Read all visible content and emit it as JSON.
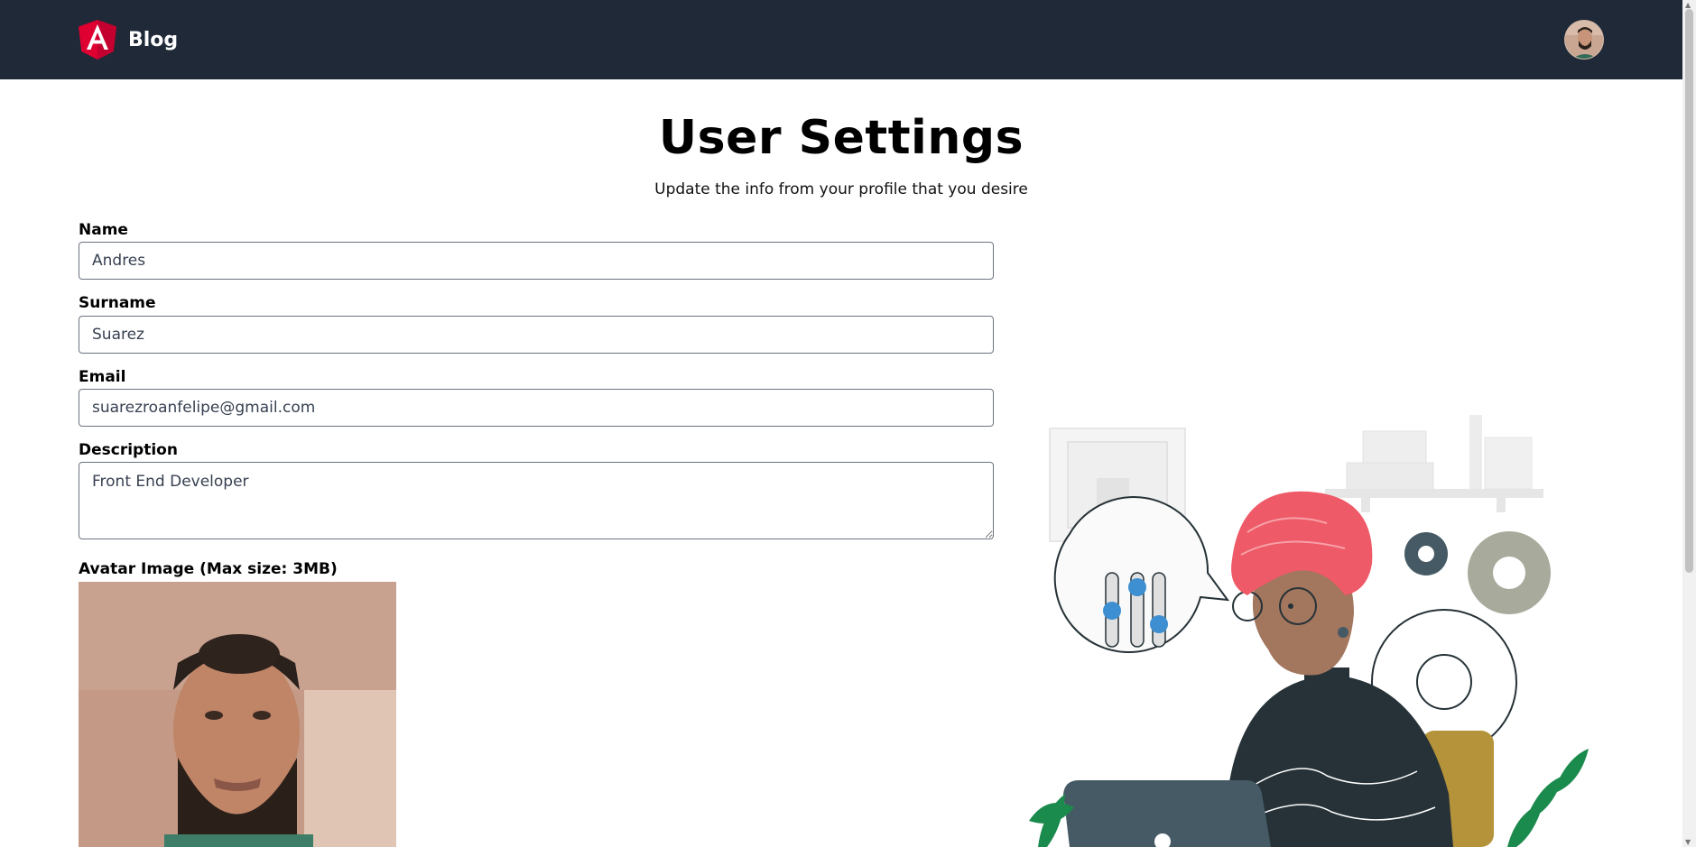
{
  "nav": {
    "brand": "Blog",
    "logo_icon": "angular-logo-icon",
    "brand_color": "#dd0031",
    "background": "#1f2937"
  },
  "header": {
    "title": "User Settings",
    "subtitle": "Update the info from your profile that you desire"
  },
  "form": {
    "name_label": "Name",
    "name_value": "Andres",
    "surname_label": "Surname",
    "surname_value": "Suarez",
    "email_label": "Email",
    "email_value": "suarezroanfelipe@gmail.com",
    "description_label": "Description",
    "description_value": "Front End Developer",
    "avatar_label": "Avatar Image (Max size: 3MB)"
  }
}
